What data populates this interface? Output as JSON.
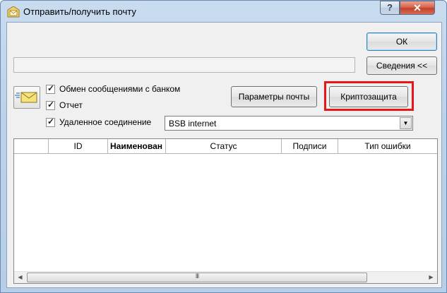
{
  "window": {
    "title": "Отправить/получить почту",
    "help_glyph": "?",
    "close_glyph": "✕"
  },
  "buttons": {
    "ok": "ОК",
    "details": "Сведения <<",
    "mail_params": "Параметры почты",
    "crypto": "Криптозащита"
  },
  "status_text": "",
  "options": [
    {
      "label": "Обмен сообщениями с банком",
      "checked": true
    },
    {
      "label": "Отчет",
      "checked": true
    },
    {
      "label": "Удаленное соединение",
      "checked": true
    }
  ],
  "connection": {
    "selected": "BSB internet"
  },
  "table": {
    "columns": [
      "",
      "ID",
      "Наименован",
      "Статус",
      "Подписи",
      "Тип ошибки"
    ],
    "rows": []
  },
  "scrollbar": {
    "grip": "III"
  },
  "colors": {
    "highlight": "#e8151b",
    "window_frame": "#bcd2ea"
  },
  "icons": {
    "mail_button": "envelope-icon",
    "title": "folder-mail-icon"
  }
}
